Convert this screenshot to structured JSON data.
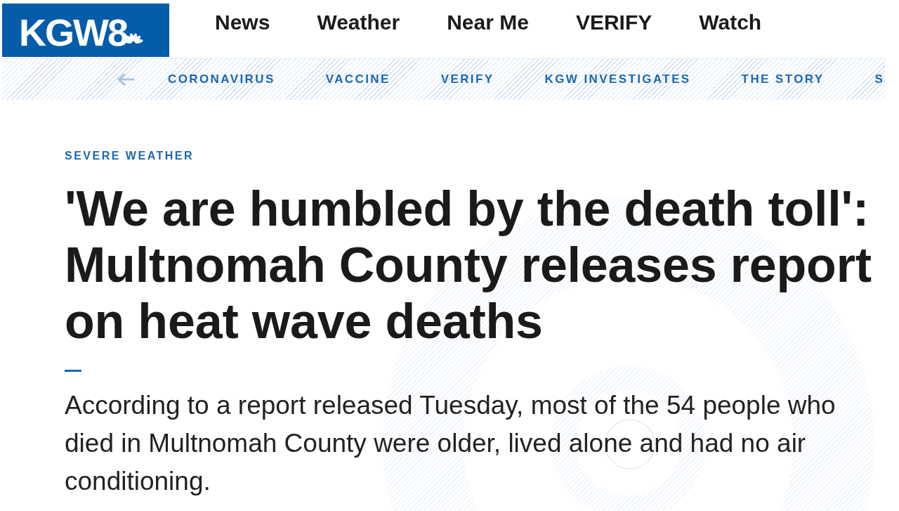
{
  "header": {
    "logo": {
      "text": "KGW8"
    },
    "nav": [
      {
        "label": "News"
      },
      {
        "label": "Weather"
      },
      {
        "label": "Near Me"
      },
      {
        "label": "VERIFY"
      },
      {
        "label": "Watch"
      }
    ]
  },
  "subnav": {
    "items": [
      {
        "label": "CORONAVIRUS"
      },
      {
        "label": "VACCINE"
      },
      {
        "label": "VERIFY"
      },
      {
        "label": "KGW INVESTIGATES"
      },
      {
        "label": "THE STORY"
      },
      {
        "label": "S"
      }
    ]
  },
  "article": {
    "category": "SEVERE WEATHER",
    "headline": "'We are humbled by the death toll': Multnomah County releases report on heat wave deaths",
    "summary": "According to a report released Tuesday, most of the 54 people who died in Multnomah County were older, lived alone and had no air conditioning."
  }
}
